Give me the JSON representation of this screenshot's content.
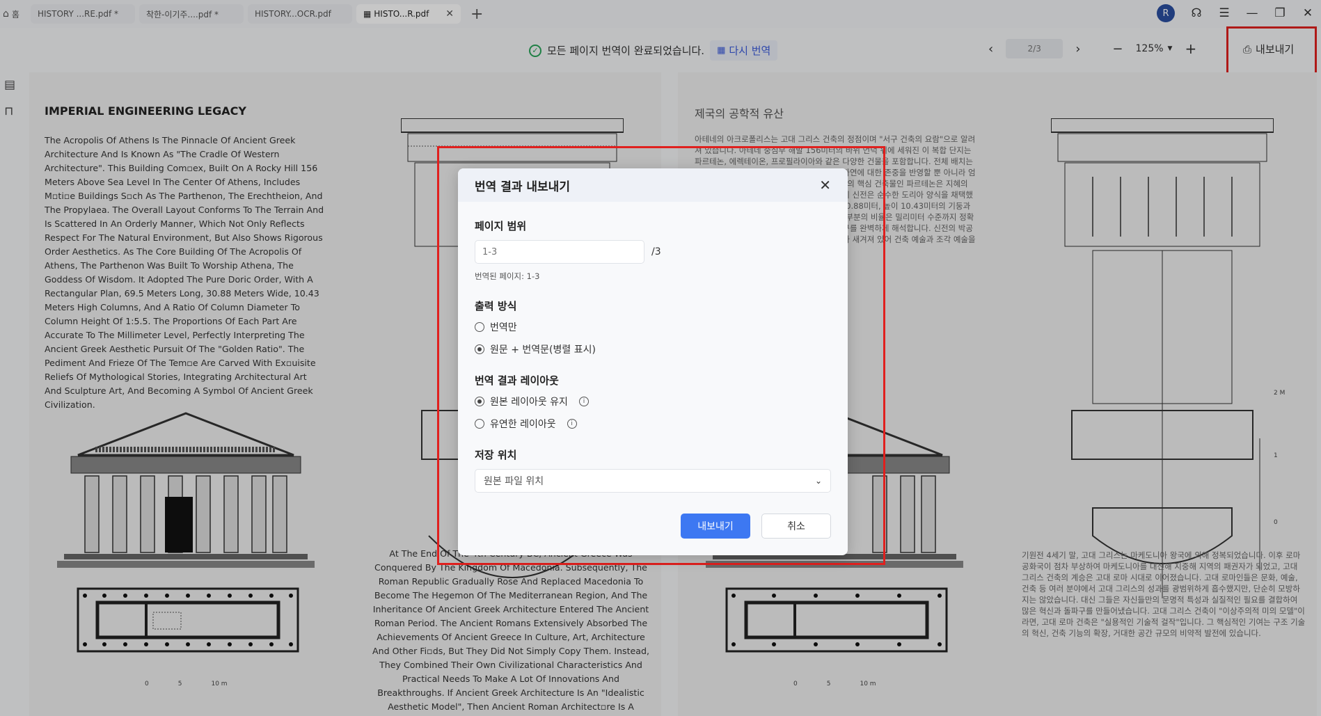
{
  "tabs": [
    {
      "label": "홈"
    },
    {
      "label": "HISTORY ...RE.pdf *"
    },
    {
      "label": "착한-이기주....pdf *"
    },
    {
      "label": "HISTORY...OCR.pdf"
    },
    {
      "label": "HISTO...R.pdf"
    }
  ],
  "user": {
    "initial": "R"
  },
  "toolbar": {
    "status_text": "모든 페이지 번역이 완료되었습니다.",
    "retranslate_label": "다시 번역",
    "page_indicator": "2/3",
    "zoom_level": "125%",
    "export_label": "내보내기"
  },
  "document_left": {
    "title": "IMPERIAL ENGINEERING LEGACY",
    "paragraph1": "The Acropolis Of Athens Is The Pinnacle Of Ancient Greek Architecture And Is Known As \"The Cradle Of Western Architecture\". This Building Com▫ex, Built On A Rocky Hill 156 Meters Above Sea Level In The Center Of Athens, Includes M▫ti▫e Buildings S▫ch As The Parthenon, The Erechtheion, And The Propylaea. The Overall Layout Conforms To The Terrain And Is Scattered In An Orderly Manner, Which Not Only Reflects Respect For The Natural Environment, But Also Shows Rigorous Order Aesthetics. As The Core Building Of The Acropolis Of Athens, The Parthenon Was Built To Worship Athena, The Goddess Of Wisdom. It Adopted The Pure Doric Order, With A Rectangular Plan, 69.5 Meters Long, 30.88 Meters Wide, 10.43 Meters High Columns, And A Ratio Of Column Diameter To Column Height Of 1:5.5. The Proportions Of Each Part Are Accurate To The Millimeter Level, Perfectly Interpreting The Ancient Greek Aesthetic Pursuit Of The \"Golden Ratio\". The Pediment And Frieze Of The Tem▫e Are Carved With Ex▫uisite Reliefs Of Mythological Stories, Integrating Architectural Art And Sculpture Art, And Becoming A Symbol Of Ancient Greek Civilization.",
    "paragraph2": "At The End Of The 4th Century BC, Ancient Greece Was Conquered By The Kingdom Of Macedonia. Subsequently, The Roman Republic Gradually Rose And Replaced Macedonia To Become The Hegemon Of The Mediterranean Region, And The Inheritance Of Ancient Greek Architecture Entered The Ancient Roman Period. The Ancient Romans Extensively Absorbed The Achievements Of Ancient Greece In Culture, Art, Architecture And Other Fi▫ds, But They Did Not Simply Copy Them. Instead, They Combined Their Own Civilizational Characteristics And Practical Needs To Make A Lot Of Innovations And Breakthroughs. If Ancient Greek Architecture Is An \"Idealistic Aesthetic Model\", Then Ancient Roman Architect▫re Is A \"Pragmatic Technical Masterpiece\". Its",
    "scale": [
      "0",
      "5",
      "10 m"
    ]
  },
  "document_right": {
    "title": "제국의 공학적 유산",
    "paragraph1": "아테네의 아크로폴리스는 고대 그리스 건축의 정점이며 \"서구 건축의 요람\"으로 알려져 있습니다. 아테네 중심부 해발 156미터의 바위 언덕 위에 세워진 이 복합 단지는 파르테논, 에렉테이온, 프로필라이아와 같은 다양한 건물을 포함합니다. 전체 배치는 지형에 순응하며 질서 정연하게 흩어져 있어 자연에 대한 존중을 반영할 뿐 아니라 엄격한 질서의 미학을 보여줍니다. 아크로폴리스의 핵심 건축물인 파르테논은 지혜의 여신 아테나를 숭배하기 위해 세워졌습니다. 이 신전은 순수한 도리아 양식을 채택했으며 직사각형 평면에 길이 69.5미터, 너비 30.88미터, 높이 10.43미터의 기둥과 기둥 지름 대비 높이 비율은 1:5.5입니다. 각 부분의 비율은 밀리미터 수준까지 정확하여 고대 그리스의 \"황금비\"에 대한 미적 추구를 완벽하게 해석합니다. 신전의 박공과 프리즈에는 신화 속 이야기의 정교한 부조가 새겨져 있어 건축 예술과 조각 예술을 통합하고",
    "paragraph2": "기원전 4세기 말, 고대 그리스는 마케도니아 왕국에 의해 정복되었습니다. 이후 로마 공화국이 점차 부상하여 마케도니아를 대신해 지중해 지역의 패권자가 되었고, 고대 그리스 건축의 계승은 고대 로마 시대로 이어졌습니다. 고대 로마인들은 문화, 예술, 건축 등 여러 분야에서 고대 그리스의 성과를 광범위하게 흡수했지만, 단순히 모방하지는 않았습니다. 대신 그들은 자신들만의 문명적 특성과 실질적인 필요를 결합하여 많은 혁신과 돌파구를 만들어냈습니다. 고대 그리스 건축이 \"이상주의적 미의 모델\"이라면, 고대 로마 건축은 \"실용적인 기술적 걸작\"입니다. 그 핵심적인 기여는 구조 기술의 혁신, 건축 기능의 확장, 거대한 공간 규모의 비약적 발전에 있습니다.",
    "scale": [
      "0",
      "5",
      "10 m"
    ],
    "column_scale": [
      "2 M",
      "1",
      "0"
    ]
  },
  "dialog": {
    "title": "번역 결과 내보내기",
    "page_range": {
      "label": "페이지 범위",
      "placeholder": "1-3",
      "total": "/3",
      "hint": "번역된 페이지: 1-3"
    },
    "output_mode": {
      "label": "출력 방식",
      "options": [
        {
          "label": "번역만",
          "selected": false
        },
        {
          "label": "원문 + 번역문(병렬 표시)",
          "selected": true
        }
      ]
    },
    "layout": {
      "label": "번역 결과 레이아웃",
      "options": [
        {
          "label": "원본 레이아웃 유지",
          "selected": true
        },
        {
          "label": "유연한 레이아웃",
          "selected": false
        }
      ]
    },
    "save_location": {
      "label": "저장 위치",
      "value": "원본 파일 위치"
    },
    "export_button": "내보내기",
    "cancel_button": "취소"
  },
  "colors": {
    "accent": "#3d78f2",
    "highlight_box": "#e0201e",
    "success": "#2aa55a",
    "avatar": "#2b4fa0"
  }
}
